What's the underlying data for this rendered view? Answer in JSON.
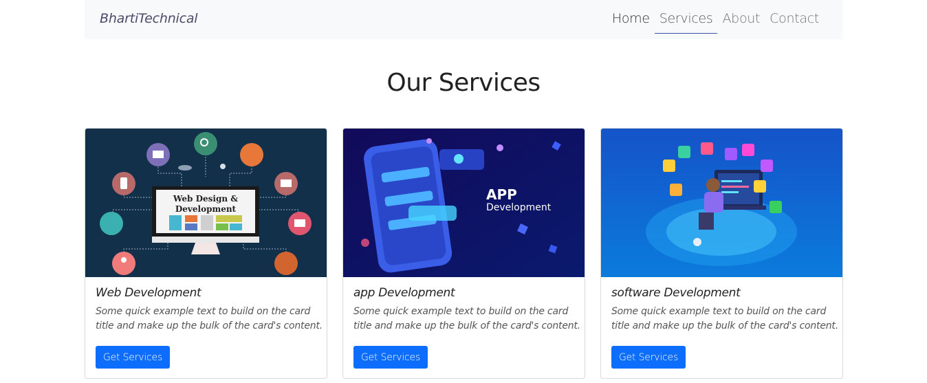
{
  "navbar": {
    "brand": "BhartiTechnical",
    "links": [
      "Home",
      "Services",
      "About",
      "Contact"
    ],
    "active_link": "Services"
  },
  "page": {
    "heading": "Our Services"
  },
  "cards": [
    {
      "title": "Web Development",
      "text": "Some quick example text to build on the card title and make up the bulk of the card's content.",
      "button": "Get Services",
      "image_text": [
        "Web Design &",
        "Development"
      ]
    },
    {
      "title": "app Development",
      "text": "Some quick example text to build on the card title and make up the bulk of the card's content.",
      "button": "Get Services",
      "image_text": [
        "APP",
        "Development"
      ]
    },
    {
      "title": "software Development",
      "text": "Some quick example text to build on the card title and make up the bulk of the card's content.",
      "button": "Get Services",
      "image_text": []
    }
  ],
  "colors": {
    "navbar_bg": "#f8f9fa",
    "primary_button": "#0d6efd",
    "active_underline": "#3d4ea8"
  }
}
